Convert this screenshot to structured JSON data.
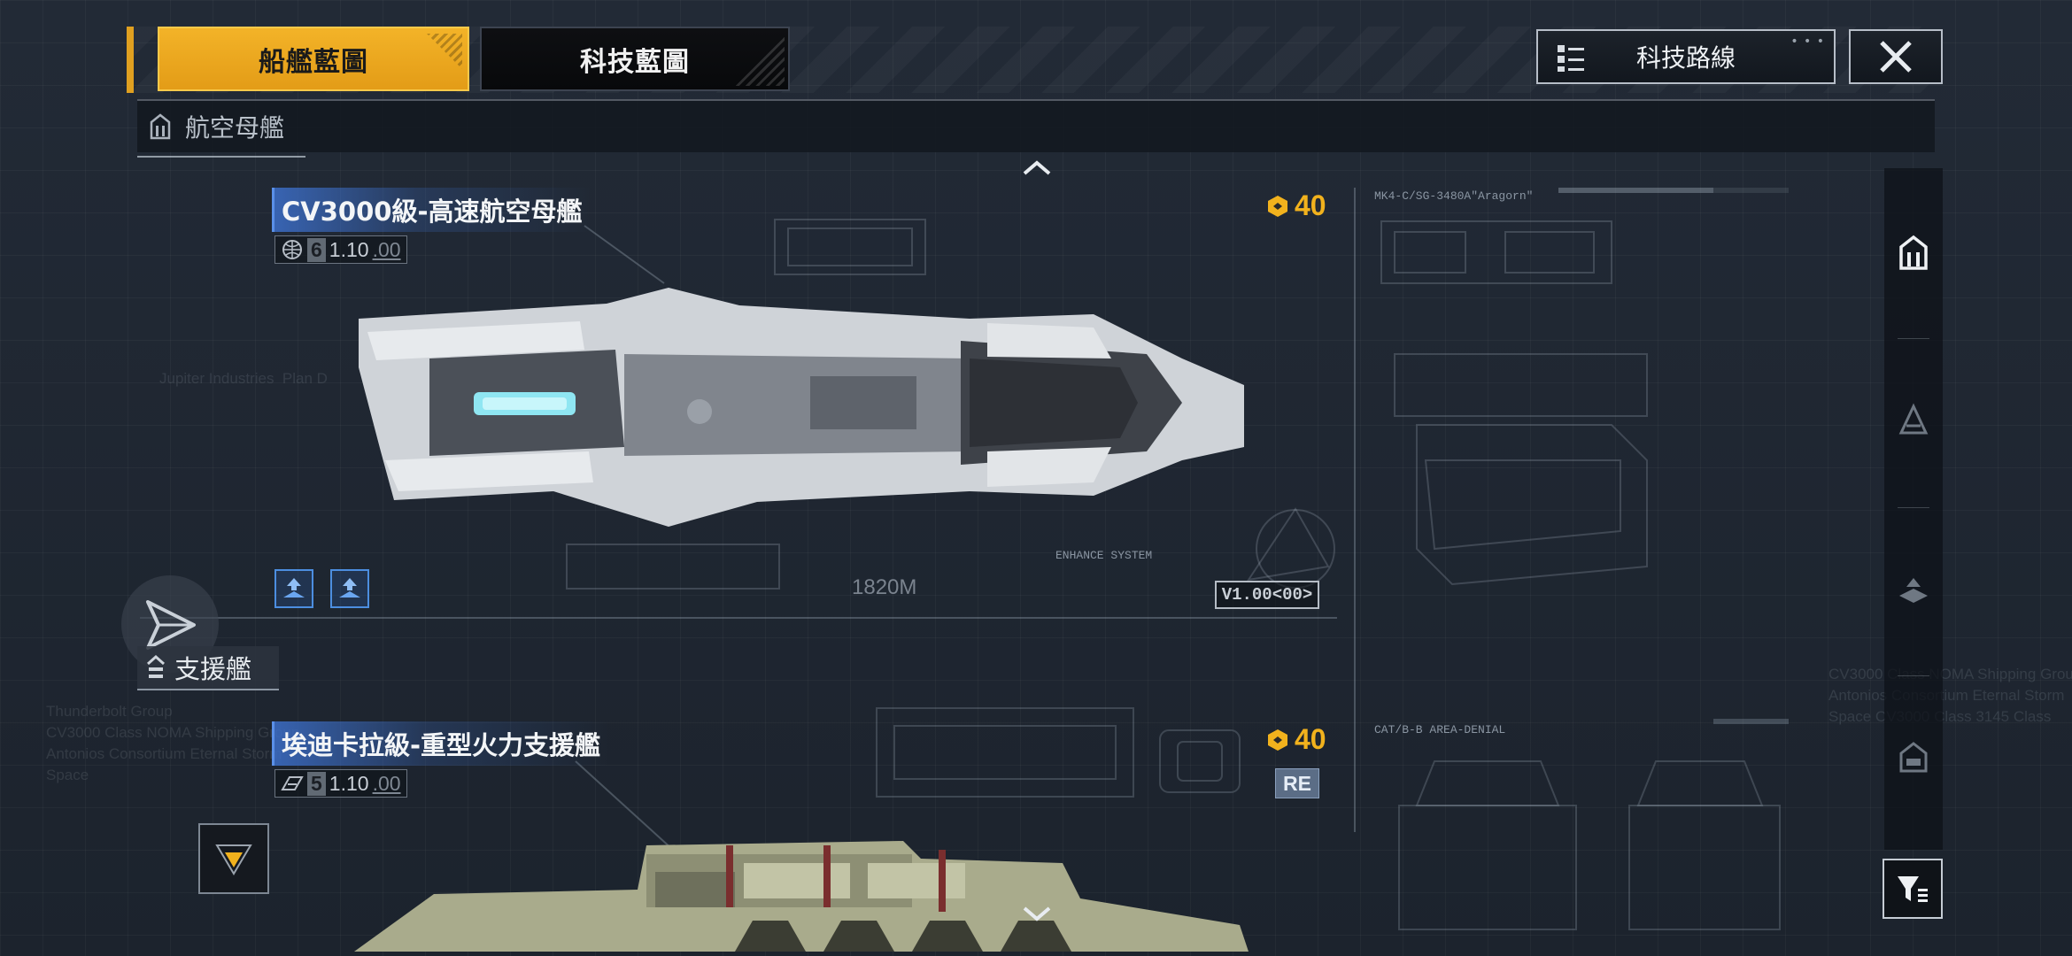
{
  "tabs": {
    "active_label": "船艦藍圖",
    "inactive_label": "科技藍圖"
  },
  "header": {
    "tech_route_label": "科技路線"
  },
  "category": {
    "title": "航空母艦"
  },
  "ships": [
    {
      "name": "CV3000級-高速航空母艦",
      "tier": "6",
      "version": "1.10",
      "version_sub": ".00",
      "cost": "40",
      "length": "1820M",
      "blueprint_version": "V1.00<00>",
      "blueprint_code": "MK4-C/SG-3480A\"Aragorn\"",
      "system_label": "ENHANCE SYSTEM"
    },
    {
      "name": "埃迪卡拉級-重型火力支援艦",
      "tier": "5",
      "version": "1.10",
      "version_sub": ".00",
      "cost": "40",
      "tag": "RE",
      "blueprint_code": "CAT/B-B AREA-DENIAL"
    }
  ],
  "support": {
    "label": "支援艦"
  },
  "background_text": {
    "left_block": "Thunderbolt Group\nCV3000 Class NOMA Shipping Group\nAntonios Consortium Eternal Storm\nSpace",
    "right_block": "CV3000 Class NOMA Shipping Group\nAntonios Consortium Eternal Storm\nSpace CV3000 Class 3145 Class",
    "left_upper": "Jupiter Industries  Plan D"
  },
  "icons": {
    "tech_route": "list-tree-icon",
    "close": "close-icon",
    "carrier": "carrier-icon",
    "launch": "launch-arrow-icon",
    "support": "support-ship-icon",
    "down": "triangle-down-icon",
    "filter": "filter-icon",
    "cost": "resource-icon"
  },
  "colors": {
    "accent": "#F2B21D",
    "tab_active": "#E8A41C",
    "title_highlight": "#3C6EC8",
    "background": "#1E2530"
  }
}
